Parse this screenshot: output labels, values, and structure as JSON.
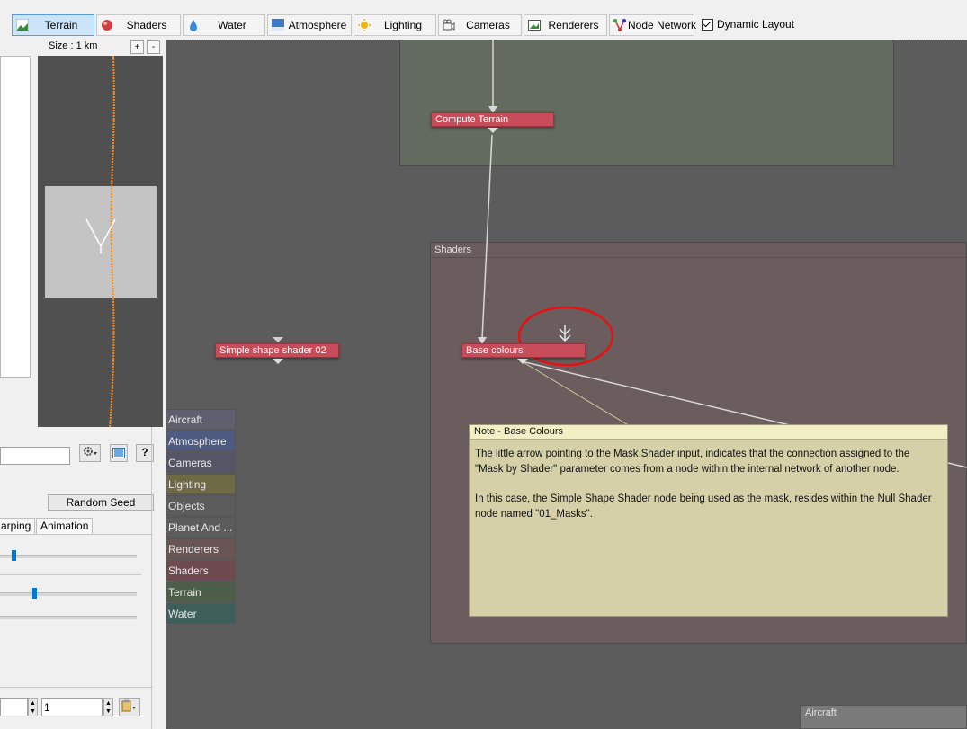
{
  "toolbar": {
    "items": [
      {
        "label": "Terrain",
        "icon": "terrain-icon",
        "active": true
      },
      {
        "label": "Shaders",
        "icon": "shader-sphere-icon",
        "active": false
      },
      {
        "label": "Water",
        "icon": "water-drop-icon",
        "active": false
      },
      {
        "label": "Atmosphere",
        "icon": "atmosphere-icon",
        "active": false
      },
      {
        "label": "Lighting",
        "icon": "sun-icon",
        "active": false
      },
      {
        "label": "Cameras",
        "icon": "camera-icon",
        "active": false
      },
      {
        "label": "Renderers",
        "icon": "renderer-icon",
        "active": false
      },
      {
        "label": "Node Network",
        "icon": "node-network-icon",
        "active": false
      }
    ],
    "dynamic_layout_label": "Dynamic Layout",
    "dynamic_layout_checked": true
  },
  "map": {
    "size_label": "Size : 1 km",
    "zoom_in": "+",
    "zoom_out": "-"
  },
  "controls": {
    "name_value": "",
    "help_label": "?",
    "random_seed_label": "Random Seed",
    "tabs": [
      "arping",
      "Animation"
    ],
    "slider1_position": 0.09,
    "slider2_position": 0.25,
    "spin1_value": "",
    "spin2_value": "1"
  },
  "network": {
    "nodes": {
      "compute_terrain": "Compute Terrain",
      "simple_shape_shader": "Simple shape shader 02",
      "base_colours": "Base colours"
    },
    "groups": {
      "shaders_title": "Shaders",
      "aircraft_title": "Aircraft"
    },
    "categories": [
      {
        "label": "Aircraft",
        "color": "#5f5f6e"
      },
      {
        "label": "Atmosphere",
        "color": "#4e5a80"
      },
      {
        "label": "Cameras",
        "color": "#555565"
      },
      {
        "label": "Lighting",
        "color": "#6e6a45"
      },
      {
        "label": "Objects",
        "color": "#5c5c5c"
      },
      {
        "label": "Planet And ...",
        "color": "#5c5c5c"
      },
      {
        "label": "Renderers",
        "color": "#6a5555"
      },
      {
        "label": "Shaders",
        "color": "#6e4a50"
      },
      {
        "label": "Terrain",
        "color": "#4c5e48"
      },
      {
        "label": "Water",
        "color": "#3e5e5a"
      }
    ],
    "note": {
      "title": "Note - Base Colours",
      "paragraph1": "The little arrow pointing to the Mask Shader input, indicates that the connection assigned to the \"Mask by Shader\" parameter comes from a node within the internal network of another node.",
      "paragraph2": "In this case, the Simple Shape Shader node being used as the mask, resides within the Null Shader node named \"01_Masks\"."
    }
  },
  "colors": {
    "network_bg": "#5c5c5c",
    "terrain_group": "#636a5e",
    "shaders_group": "#6b5d5d",
    "node_red": "#c84b5a",
    "highlight_circle": "#e81010"
  }
}
